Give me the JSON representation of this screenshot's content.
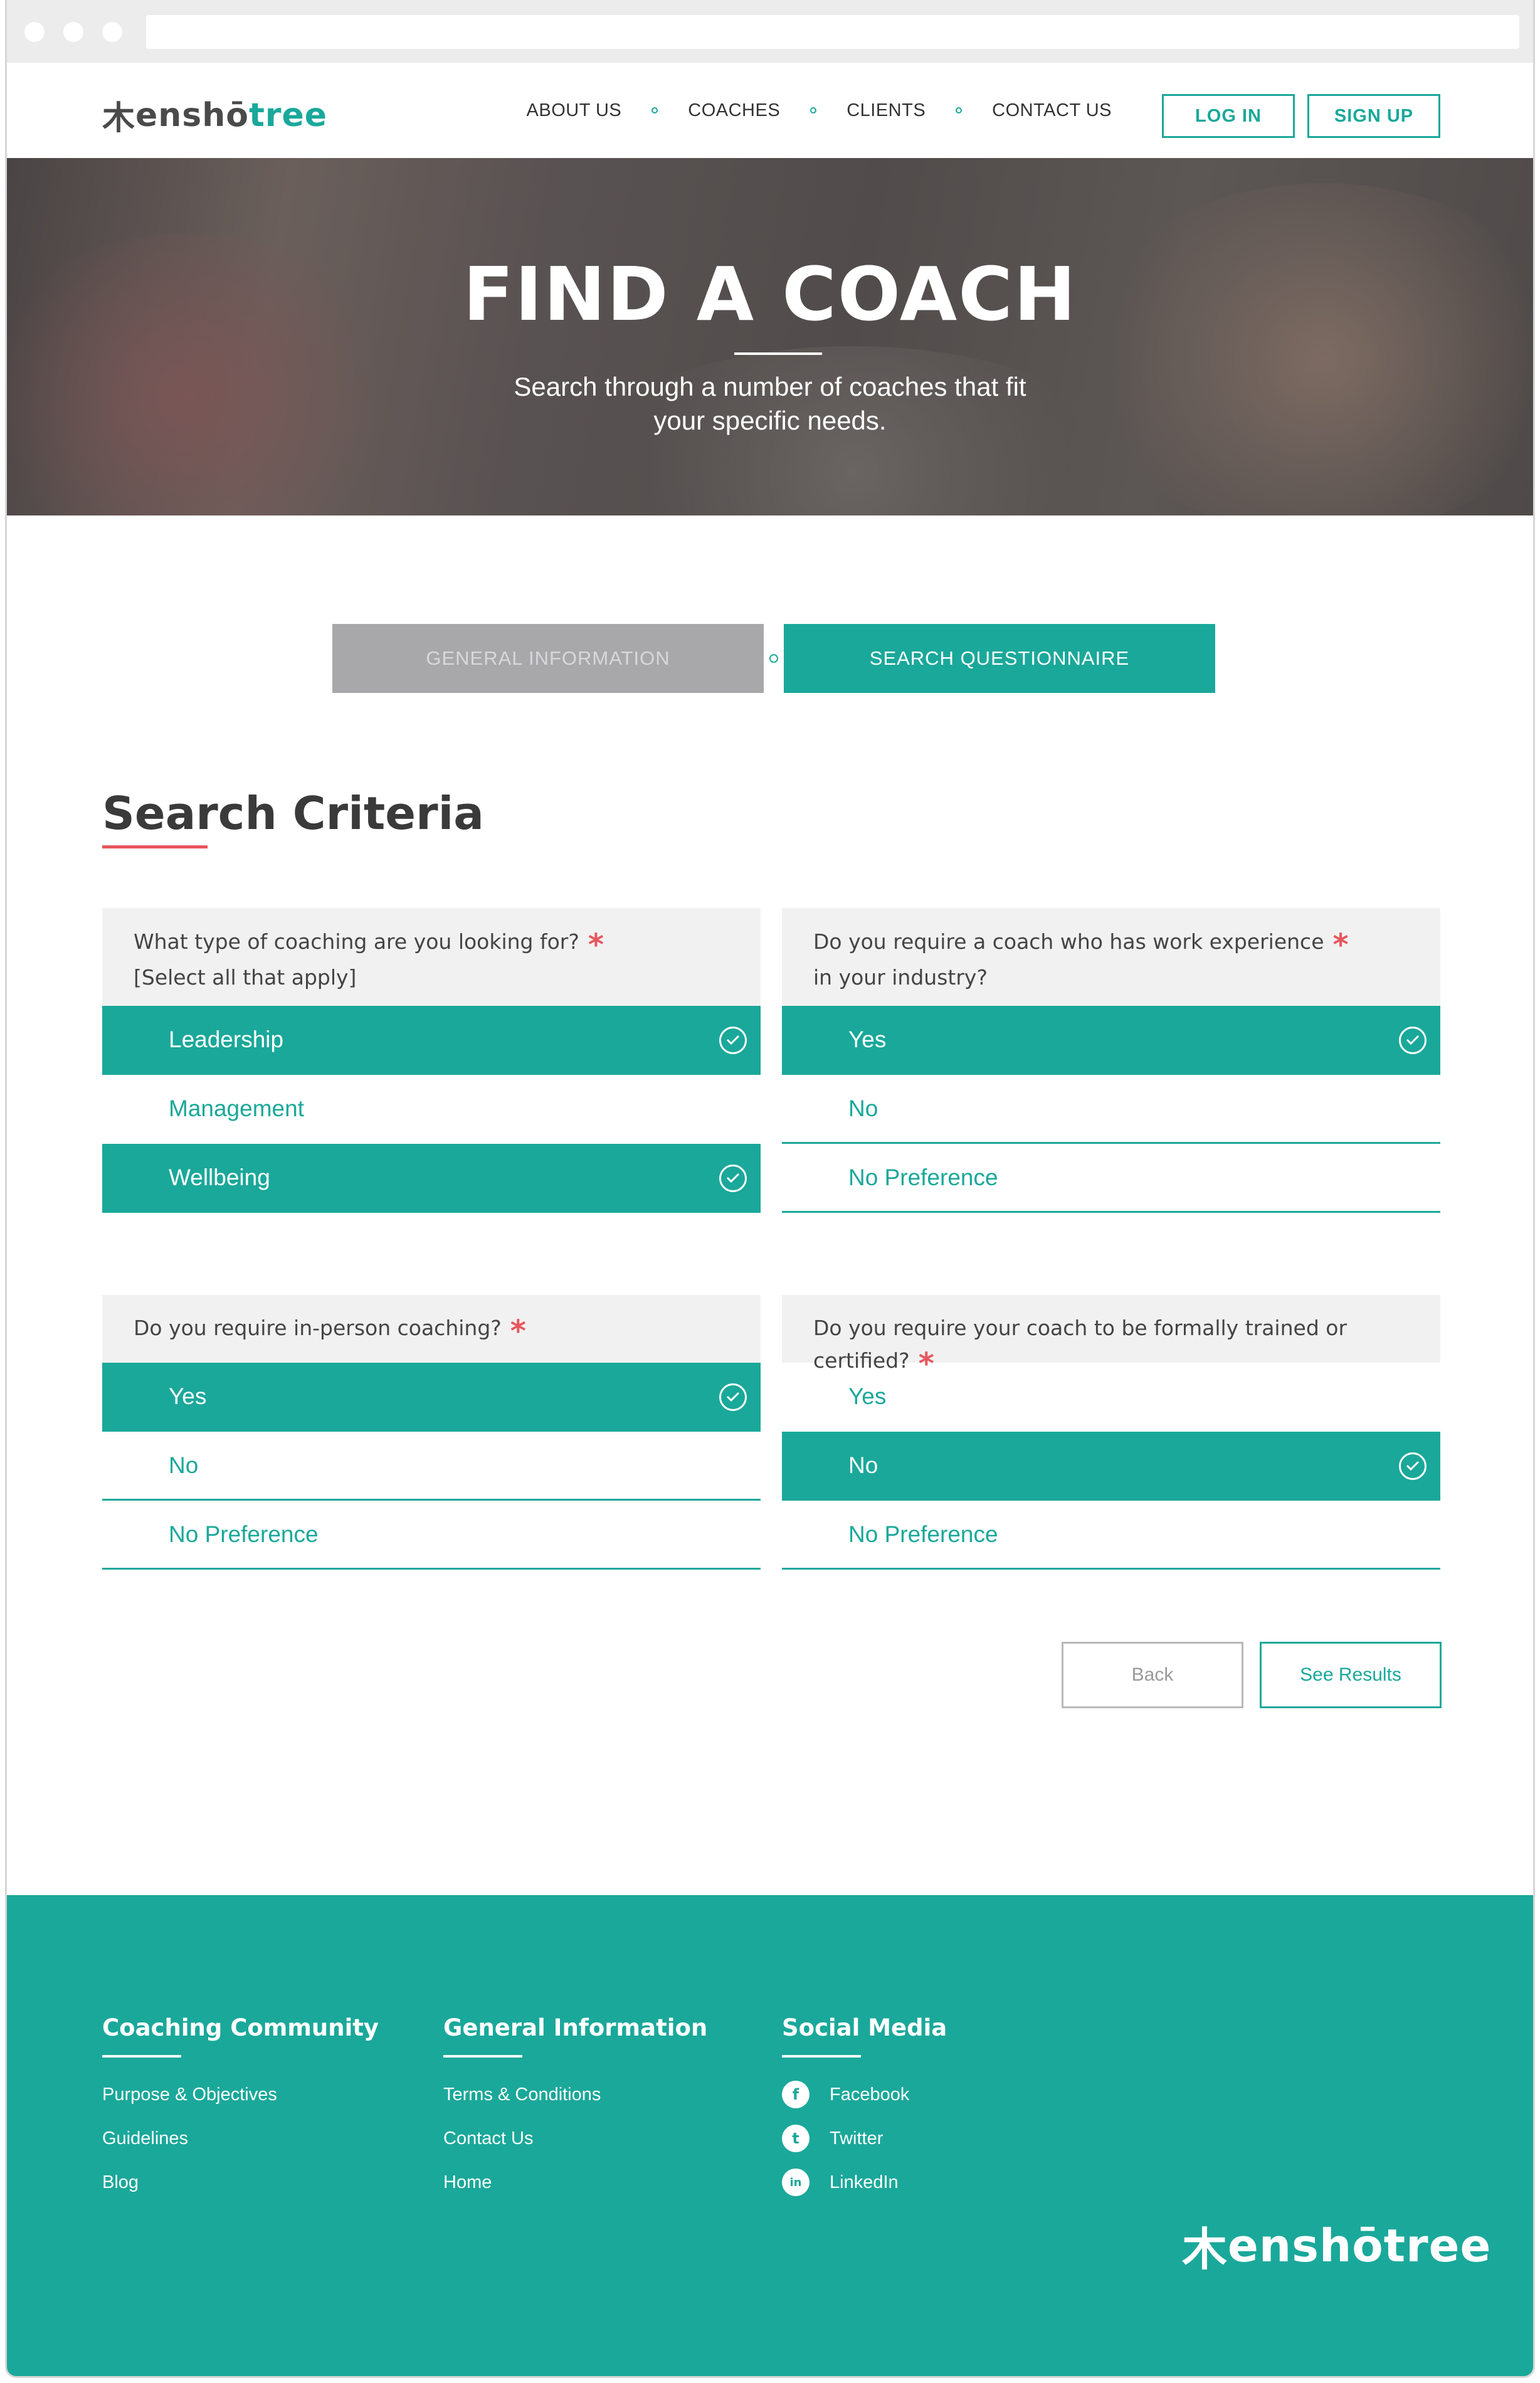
{
  "nav": {
    "logo": {
      "prefix": "木",
      "main": "enshō",
      "accent": "tree"
    },
    "links": [
      "ABOUT US",
      "COACHES",
      "CLIENTS",
      "CONTACT US"
    ],
    "login": "LOG IN",
    "signup": "SIGN UP"
  },
  "hero": {
    "title": "FIND A COACH",
    "subtitle_line1": "Search through a number of coaches that fit",
    "subtitle_line2": "your specific needs."
  },
  "steps": {
    "general": "GENERAL INFORMATION",
    "search": "SEARCH QUESTIONNAIRE",
    "active": "search"
  },
  "section": {
    "title": "Search Criteria"
  },
  "questions": [
    {
      "line1": "What type of coaching are you looking for?",
      "line2": "[Select all that apply]",
      "required": "*",
      "options": [
        {
          "label": "Leadership",
          "selected": true
        },
        {
          "label": "Management",
          "selected": false
        },
        {
          "label": "Wellbeing",
          "selected": true
        }
      ]
    },
    {
      "line1": "Do you require a coach who has work experience",
      "line2": "in your industry?",
      "required": "*",
      "options": [
        {
          "label": "Yes",
          "selected": true
        },
        {
          "label": "No",
          "selected": false
        },
        {
          "label": "No Preference",
          "selected": false
        }
      ]
    },
    {
      "line1": "Do you require in-person coaching?",
      "required": "*",
      "options": [
        {
          "label": "Yes",
          "selected": true
        },
        {
          "label": "No",
          "selected": false
        },
        {
          "label": "No Preference",
          "selected": false
        }
      ]
    },
    {
      "line1": "Do you require your coach to be formally trained or certified?",
      "required": "*",
      "options": [
        {
          "label": "Yes",
          "selected": false
        },
        {
          "label": "No",
          "selected": true
        },
        {
          "label": "No Preference",
          "selected": false
        }
      ]
    }
  ],
  "actions": {
    "back": "Back",
    "results": "See Results"
  },
  "footer": {
    "col1": {
      "title": "Coaching Community",
      "items": [
        "Purpose & Objectives",
        "Guidelines",
        "Blog"
      ]
    },
    "col2": {
      "title": "General Information",
      "items": [
        "Terms & Conditions",
        "Contact Us",
        "Home"
      ]
    },
    "col3": {
      "title": "Social Media",
      "items": [
        {
          "icon": "facebook-icon",
          "glyph": "f",
          "label": "Facebook"
        },
        {
          "icon": "twitter-icon",
          "glyph": "t",
          "label": "Twitter"
        },
        {
          "icon": "linkedin-icon",
          "glyph": "in",
          "label": "LinkedIn"
        }
      ]
    }
  },
  "colors": {
    "brand": "#1aa89a",
    "accent_red": "#e8555e",
    "disabled_step": "#a8a8ab"
  }
}
